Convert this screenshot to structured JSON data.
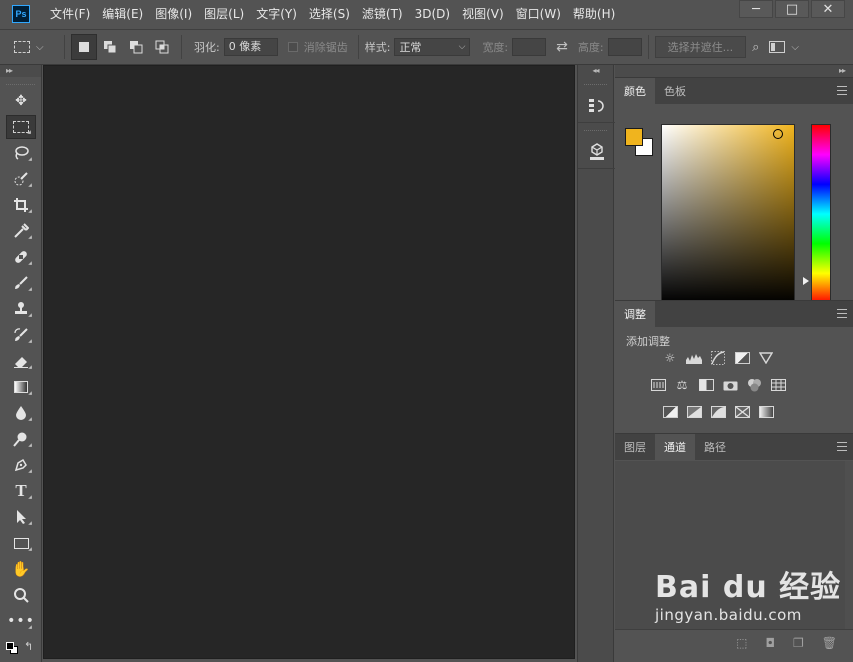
{
  "app": {
    "logo_text": "Ps"
  },
  "menu": [
    "文件(F)",
    "编辑(E)",
    "图像(I)",
    "图层(L)",
    "文字(Y)",
    "选择(S)",
    "滤镜(T)",
    "3D(D)",
    "视图(V)",
    "窗口(W)",
    "帮助(H)"
  ],
  "window_controls": {
    "minimize": "─",
    "maximize": "□",
    "close": "✕"
  },
  "options": {
    "feather_label": "羽化:",
    "feather_value": "0 像素",
    "antialias_label": "消除锯齿",
    "style_label": "样式:",
    "style_value": "正常",
    "width_label": "宽度:",
    "height_label": "高度:",
    "select_mask_label": "选择并遮住..."
  },
  "panels": {
    "color": {
      "tabs": [
        "颜色",
        "色板"
      ],
      "active_tab": 0,
      "foreground": "#f0b41e",
      "background": "#ffffff"
    },
    "adjustments": {
      "tab": "调整",
      "title": "添加调整"
    },
    "layers": {
      "tabs": [
        "图层",
        "通道",
        "路径"
      ],
      "active_tab": 1
    }
  },
  "watermark": {
    "line1": "Bai du 经验",
    "line2": "jingyan.baidu.com"
  },
  "colors": {
    "ui_bg": "#535353",
    "canvas_bg": "#262626",
    "accent": "#31a8ff"
  }
}
